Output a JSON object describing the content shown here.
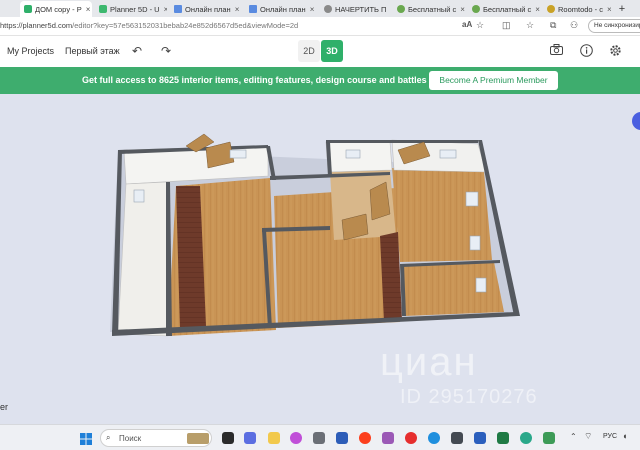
{
  "browser": {
    "tabs": [
      {
        "label": "ДОМ copy - P",
        "active": true,
        "color": "#2fb06a"
      },
      {
        "label": "Planner 5D - U",
        "active": false,
        "color": "#3db86f"
      },
      {
        "label": "Онлайн план",
        "active": false,
        "color": "#5a8be0"
      },
      {
        "label": "Онлайн план",
        "active": false,
        "color": "#5a8be0"
      },
      {
        "label": "НАЧЕРТИТЬ П",
        "active": false,
        "color": "#8a8a8a"
      },
      {
        "label": "Бесплатный с",
        "active": false,
        "color": "#6aa84f"
      },
      {
        "label": "Бесплатный с",
        "active": false,
        "color": "#6aa84f"
      },
      {
        "label": "Roomtodo - c",
        "active": false,
        "color": "#c9a227"
      }
    ],
    "new_tab": "+",
    "url_main": "https://planner5d.com",
    "url_rest": "/editor?key=57e563152031bebab24e852d6567d5ed&viewMode=2d",
    "sync_label": "Не синхронизир"
  },
  "toolbar": {
    "my_projects": "My Projects",
    "floor": "Первый этаж",
    "mode_2d": "2D",
    "mode_3d": "3D",
    "undo_icon": "undo-icon",
    "redo_icon": "redo-icon",
    "camera_icon": "camera-icon",
    "info_icon": "info-icon",
    "settings_icon": "settings-icon"
  },
  "banner": {
    "text": "Get full access to 8625 interior items, editing features, design course and battles",
    "button": "Become A Premium Member",
    "color": "#3ead6e"
  },
  "viewport": {
    "side_label": "er",
    "watermark_brand": "циан",
    "watermark_id": "ID 295170276"
  },
  "taskbar": {
    "search_placeholder": "Поиск",
    "language": "РУС"
  }
}
